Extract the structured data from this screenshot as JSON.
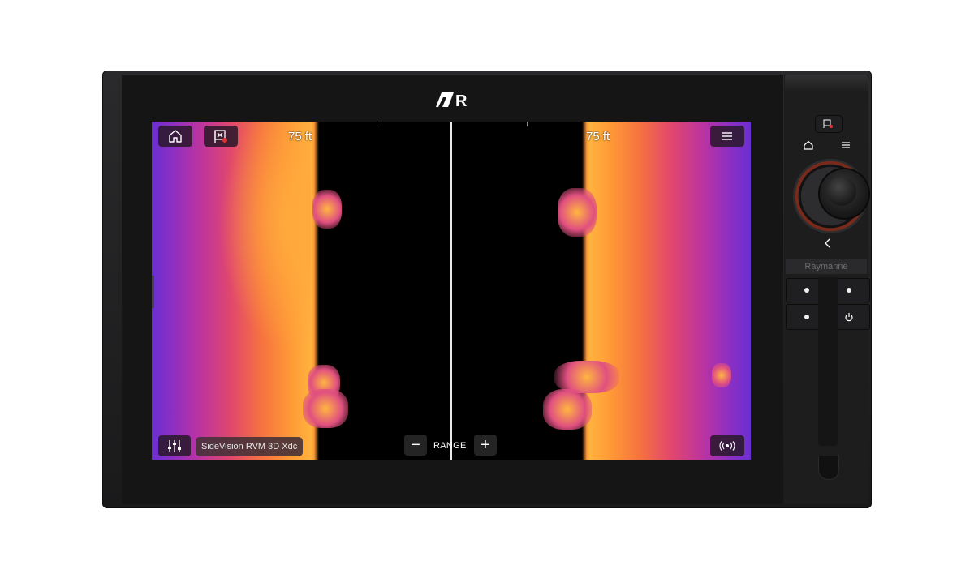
{
  "brand": {
    "logo_text": "R",
    "panel_label": "Raymarine"
  },
  "screen": {
    "range_left": "75 ft",
    "range_right": "75 ft",
    "source_label": "SideVision RVM 3D Xdc",
    "range_control_label": "RANGE"
  },
  "toolbar": {
    "home_icon": "home-icon",
    "waypoint_icon": "waypoint-flag-icon",
    "menu_icon": "menu-icon",
    "settings_icon": "sliders-icon",
    "sonar_icon": "sonar-ping-icon"
  },
  "range_buttons": {
    "minus": "−",
    "plus": "+"
  },
  "colors": {
    "palette_low": "#6a2fd0",
    "palette_mid": "#e0466e",
    "palette_high": "#ffb640",
    "button_bg": "#281828"
  },
  "panel_keys": {
    "home_icon": "home-icon",
    "menu_icon": "menu-icon",
    "back_icon": "back-chevron-icon",
    "power_icon": "power-icon",
    "waypoint_key_icon": "waypoint-mob-icon"
  }
}
